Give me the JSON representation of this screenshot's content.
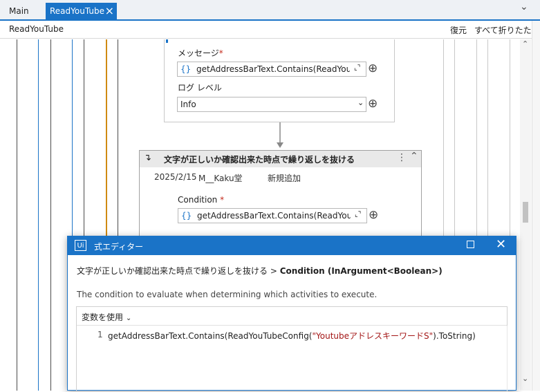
{
  "tabs": [
    {
      "label": "Main"
    },
    {
      "label": "ReadYouTube",
      "close": "×"
    }
  ],
  "tabbar": {
    "chevron": "⌄"
  },
  "breadcrumb": {
    "path": "ReadYouTube",
    "restore": "復元",
    "collapse_all": "すべて折りたたむ"
  },
  "log_activity": {
    "message_label": "メッセージ",
    "message_required": "*",
    "message_value": "getAddressBarText.Contains(ReadYouTube",
    "level_label": "ログ レベル",
    "level_value": "Info"
  },
  "break_activity": {
    "title": "文字が正しいか確認出来た時点で繰り返しを抜ける",
    "date": "2025/2/15",
    "author": "M__Kaku堂",
    "note": "新規追加",
    "condition_label": "Condition",
    "condition_required": "*",
    "condition_value": "getAddressBarText.Contains(ReadYouTube"
  },
  "icons": {
    "braces": "{}",
    "expand": "⌞⌝",
    "plus": "⊕",
    "menu": "⋮",
    "collapse": "⌃"
  },
  "dialog": {
    "logo": "Ui",
    "title": "式エディター",
    "path_prefix": "文字が正しいか確認出来た時点で繰り返しを抜ける",
    "path_sep": ">",
    "path_target": "Condition (InArgument<Boolean>)",
    "description": "The condition to evaluate when determining which activities to execute.",
    "use_variables": "変数を使用",
    "line_number": "1",
    "code_before": "getAddressBarText.Contains(ReadYouTubeConfig(",
    "code_string": "\"YoutubeアドレスキーワードS\"",
    "code_after": ").ToString)"
  },
  "colors": {
    "accent": "#1a73c7",
    "string": "#a31515",
    "orange_line": "#d08a12"
  }
}
